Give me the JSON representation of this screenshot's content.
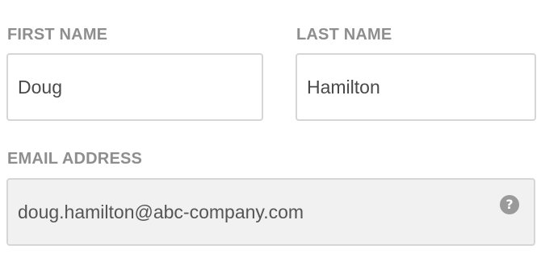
{
  "form": {
    "first_name": {
      "label": "FIRST NAME",
      "value": "Doug"
    },
    "last_name": {
      "label": "LAST NAME",
      "value": "Hamilton"
    },
    "email": {
      "label": "EMAIL ADDRESS",
      "value": "doug.hamilton@abc-company.com",
      "readonly": true,
      "help_icon": "question-circle-icon",
      "help_glyph": "?"
    }
  }
}
